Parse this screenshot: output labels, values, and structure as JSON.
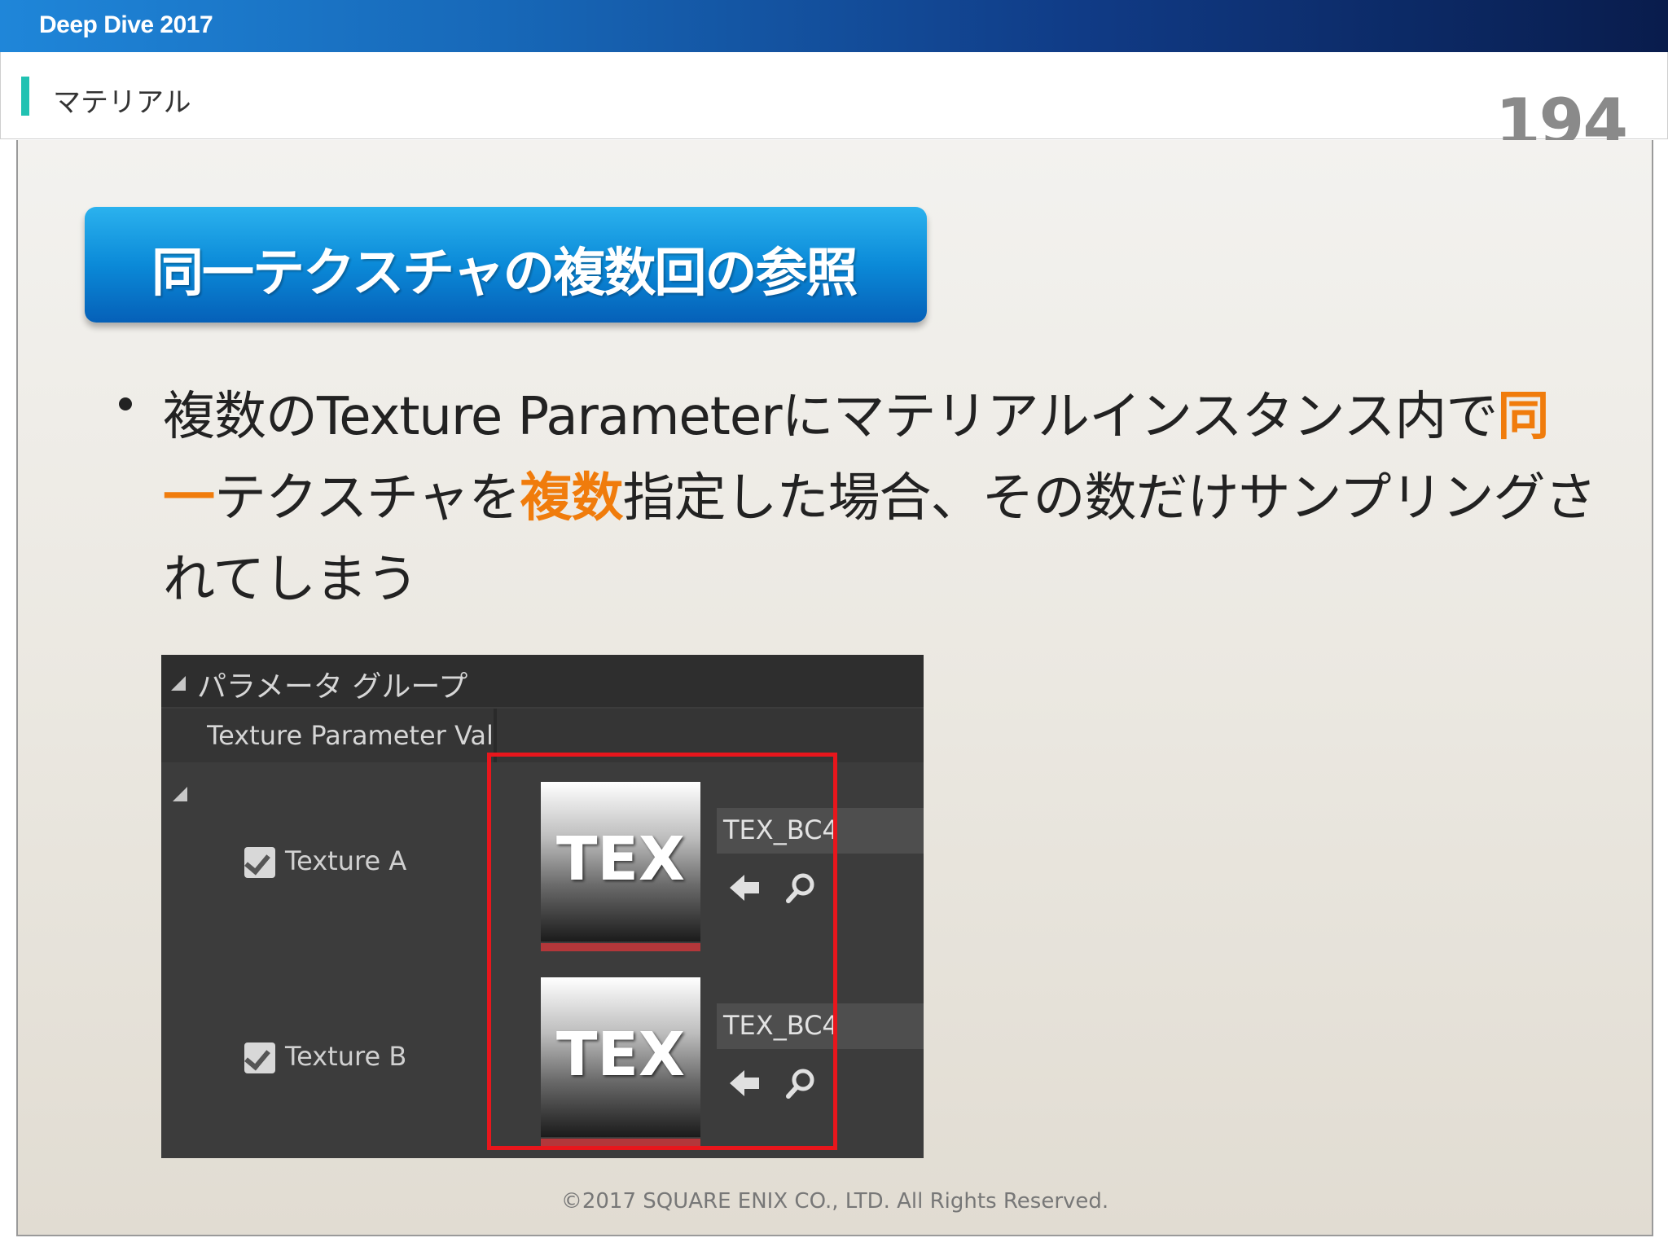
{
  "topbar": {
    "title": "Deep Dive 2017"
  },
  "header": {
    "section": "マテリアル",
    "page_number": "194"
  },
  "heading": {
    "text": "同一テクスチャの複数回の参照"
  },
  "bullet": {
    "part1": "複数のTexture Parameterにマテリアルインスタンス内で",
    "hl1": "同一",
    "part2": "テクスチャを",
    "hl2": "複数",
    "part3": "指定した場合、その数だけサンプリングされてしまう"
  },
  "panel": {
    "group_title": "パラメータ グループ",
    "section_title": "Texture Parameter Valu",
    "rows": [
      {
        "label": "Texture A",
        "checked": true,
        "thumb_text": "TEX",
        "texture_name": "TEX_BC4"
      },
      {
        "label": "Texture B",
        "checked": true,
        "thumb_text": "TEX",
        "texture_name": "TEX_BC4"
      }
    ]
  },
  "footer": {
    "copyright": "©2017 SQUARE ENIX CO., LTD. All Rights Reserved."
  },
  "colors": {
    "accent_teal": "#21c2b2",
    "highlight_orange": "#f07c0c",
    "frame_red": "#e8161c",
    "heading_blue": "#0b8ad8"
  },
  "icons": [
    "checkbox-icon",
    "arrow-left-icon",
    "search-icon",
    "collapse-triangle-icon"
  ]
}
